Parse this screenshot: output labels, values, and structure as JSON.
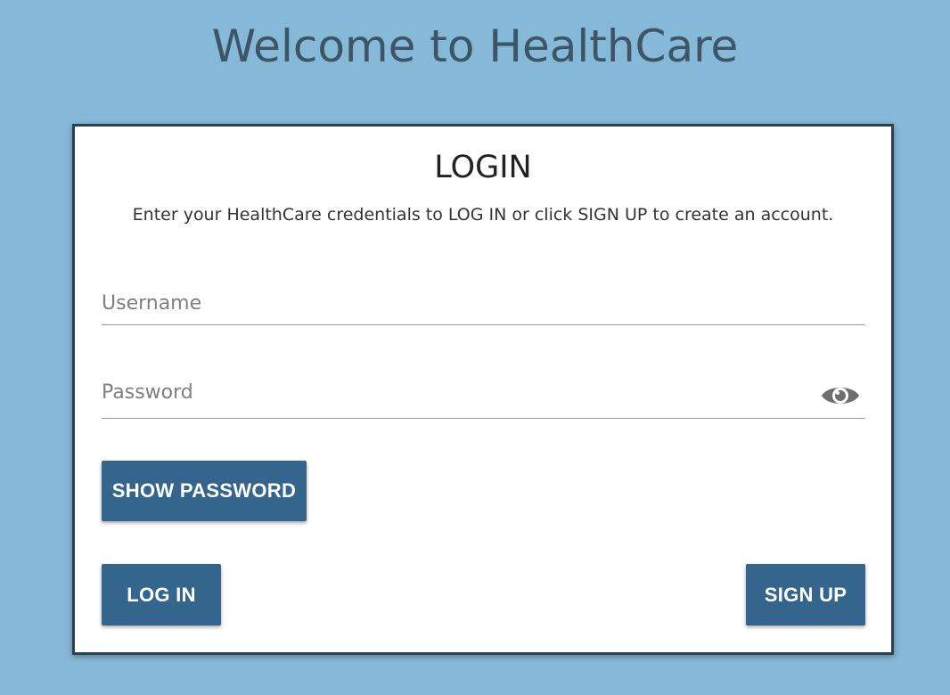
{
  "page": {
    "title": "Welcome to HealthCare"
  },
  "card": {
    "heading": "LOGIN",
    "subtitle": "Enter your HealthCare credentials to LOG IN or click SIGN UP to create an account."
  },
  "username": {
    "placeholder": "Username",
    "value": ""
  },
  "password": {
    "placeholder": "Password",
    "value": "",
    "toggle_icon": "eye-icon"
  },
  "buttons": {
    "show_password": "SHOW PASSWORD",
    "log_in": "LOG IN",
    "sign_up": "SIGN UP"
  },
  "colors": {
    "background": "#85b9d7",
    "title_text": "#3d5566",
    "card_border": "#2c4150",
    "button": "#34658c",
    "button_text": "#ffffff"
  }
}
